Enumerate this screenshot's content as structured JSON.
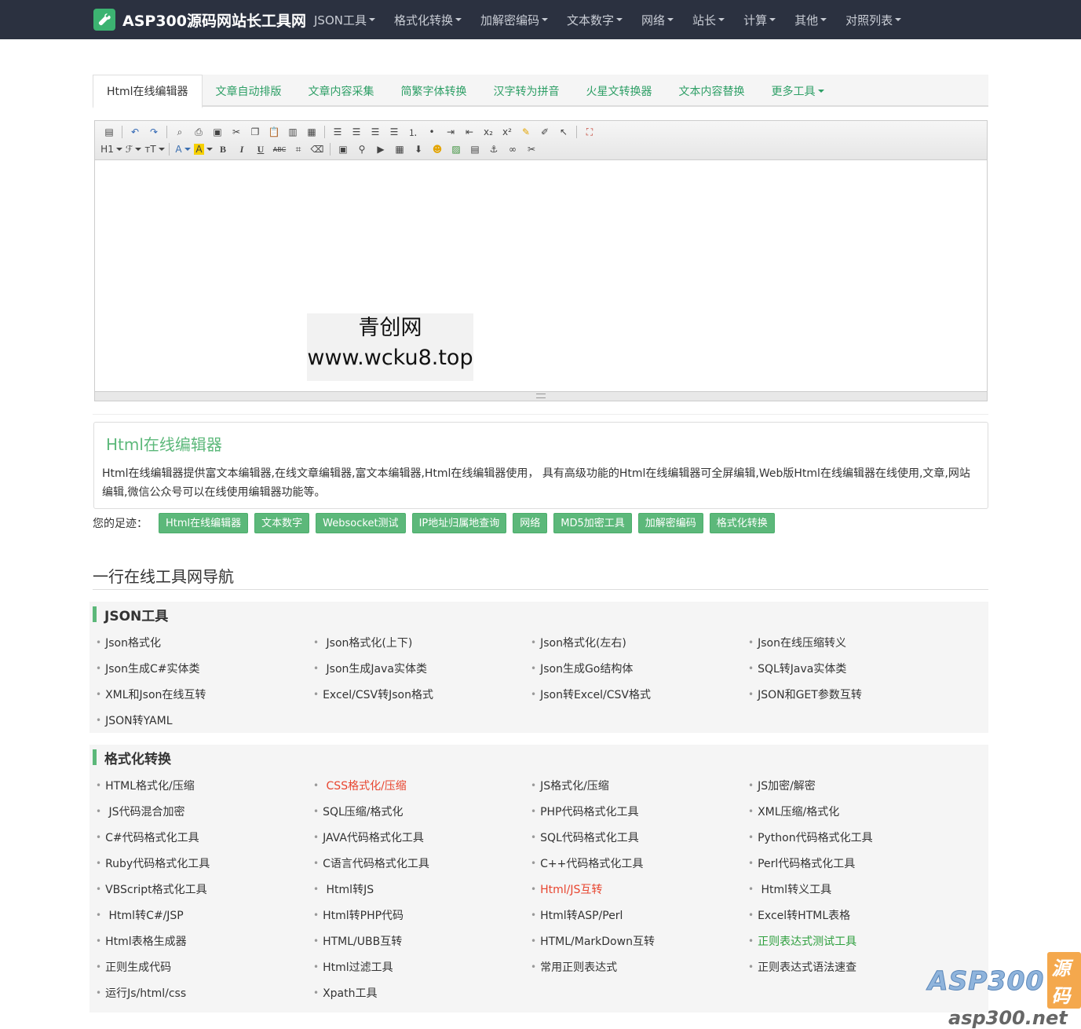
{
  "brand": {
    "title": "ASP300源码网站长工具网"
  },
  "nav": {
    "items": [
      "JSON工具",
      "格式化转换",
      "加解密编码",
      "文本数字",
      "网络",
      "站长",
      "计算",
      "其他",
      "对照列表"
    ]
  },
  "tabs": [
    "Html在线编辑器",
    "文章自动排版",
    "文章内容采集",
    "简繁字体转换",
    "汉字转为拼音",
    "火星文转换器",
    "文本内容替换",
    "更多工具"
  ],
  "toolbar": {
    "row1": [
      "source-icon",
      "undo-icon",
      "redo-icon",
      "preview-icon",
      "print-icon",
      "template-icon",
      "cut-icon",
      "copy-icon",
      "paste-icon",
      "paste-text-icon",
      "paste-word-icon",
      "align-left-icon",
      "align-center-icon",
      "align-right-icon",
      "align-justify-icon",
      "ordered-list-icon",
      "unordered-list-icon",
      "indent-icon",
      "outdent-icon",
      "subscript-icon",
      "superscript-icon",
      "clear-format-icon",
      "select-all-icon",
      "cursor-icon",
      "fullscreen-icon"
    ],
    "row2_text": {
      "h1": "H1",
      "font": "ℱ",
      "size": "ᴛT",
      "color": "A",
      "bg": "A",
      "bold": "B",
      "italic": "I",
      "underline": "U",
      "strike": "ABC"
    }
  },
  "editor_watermark": {
    "line1": "青创网",
    "line2": "www.wcku8.top"
  },
  "description": {
    "title": "Html在线编辑器",
    "text": "Html在线编辑器提供富文本编辑器,在线文章编辑器,富文本编辑器,Html在线编辑器使用， 具有高级功能的Html在线编辑器可全屏编辑,Web版Html在线编辑器在线使用,文章,网站编辑,微信公众号可以在线使用编辑器功能等。"
  },
  "history": {
    "label": "您的足迹：",
    "chips": [
      "Html在线编辑器",
      "文本数字",
      "Websocket测试",
      "IP地址归属地查询",
      "网络",
      "MD5加密工具",
      "加解密编码",
      "格式化转换"
    ]
  },
  "nav_section": {
    "title": "一行在线工具网导航",
    "categories": [
      {
        "name": "JSON工具",
        "items": [
          {
            "label": "Json格式化",
            "color": ""
          },
          {
            "label": " Json格式化(上下)",
            "color": ""
          },
          {
            "label": "Json格式化(左右)",
            "color": ""
          },
          {
            "label": "Json在线压缩转义",
            "color": ""
          },
          {
            "label": "Json生成C#实体类",
            "color": ""
          },
          {
            "label": " Json生成Java实体类",
            "color": ""
          },
          {
            "label": "Json生成Go结构体",
            "color": ""
          },
          {
            "label": "SQL转Java实体类",
            "color": ""
          },
          {
            "label": "XML和Json在线互转",
            "color": ""
          },
          {
            "label": "Excel/CSV转Json格式",
            "color": ""
          },
          {
            "label": "Json转Excel/CSV格式",
            "color": ""
          },
          {
            "label": "JSON和GET参数互转",
            "color": ""
          },
          {
            "label": "JSON转YAML",
            "color": ""
          }
        ]
      },
      {
        "name": "格式化转换",
        "items": [
          {
            "label": "HTML格式化/压缩",
            "color": ""
          },
          {
            "label": " CSS格式化/压缩",
            "color": "red"
          },
          {
            "label": "JS格式化/压缩",
            "color": ""
          },
          {
            "label": "JS加密/解密",
            "color": ""
          },
          {
            "label": " JS代码混合加密",
            "color": ""
          },
          {
            "label": "SQL压缩/格式化",
            "color": ""
          },
          {
            "label": "PHP代码格式化工具",
            "color": ""
          },
          {
            "label": "XML压缩/格式化",
            "color": ""
          },
          {
            "label": "C#代码格式化工具",
            "color": ""
          },
          {
            "label": "JAVA代码格式化工具",
            "color": ""
          },
          {
            "label": "SQL代码格式化工具",
            "color": ""
          },
          {
            "label": "Python代码格式化工具",
            "color": ""
          },
          {
            "label": "Ruby代码格式化工具",
            "color": ""
          },
          {
            "label": "C语言代码格式化工具",
            "color": ""
          },
          {
            "label": "C++代码格式化工具",
            "color": ""
          },
          {
            "label": "Perl代码格式化工具",
            "color": ""
          },
          {
            "label": "VBScript格式化工具",
            "color": ""
          },
          {
            "label": " Html转JS",
            "color": ""
          },
          {
            "label": "Html/JS互转",
            "color": "red"
          },
          {
            "label": " Html转义工具",
            "color": ""
          },
          {
            "label": " Html转C#/JSP",
            "color": ""
          },
          {
            "label": "Html转PHP代码",
            "color": ""
          },
          {
            "label": "Html转ASP/Perl",
            "color": ""
          },
          {
            "label": "Excel转HTML表格",
            "color": ""
          },
          {
            "label": "Html表格生成器",
            "color": ""
          },
          {
            "label": "HTML/UBB互转",
            "color": ""
          },
          {
            "label": "HTML/MarkDown互转",
            "color": ""
          },
          {
            "label": "正则表达式测试工具",
            "color": "green"
          },
          {
            "label": "正则生成代码",
            "color": ""
          },
          {
            "label": "Html过滤工具",
            "color": ""
          },
          {
            "label": "常用正则表达式",
            "color": ""
          },
          {
            "label": "正则表达式语法速查",
            "color": ""
          },
          {
            "label": "运行Js/html/css",
            "color": ""
          },
          {
            "label": "Xpath工具",
            "color": ""
          }
        ]
      }
    ]
  },
  "corner_logo": {
    "brand": "ASP300",
    "badge": "源码",
    "url": "asp300.net"
  },
  "colors": {
    "navbar": "#2b3140",
    "accent": "#5cb87a",
    "red": "#e8452f",
    "green": "#2e9f3e"
  }
}
